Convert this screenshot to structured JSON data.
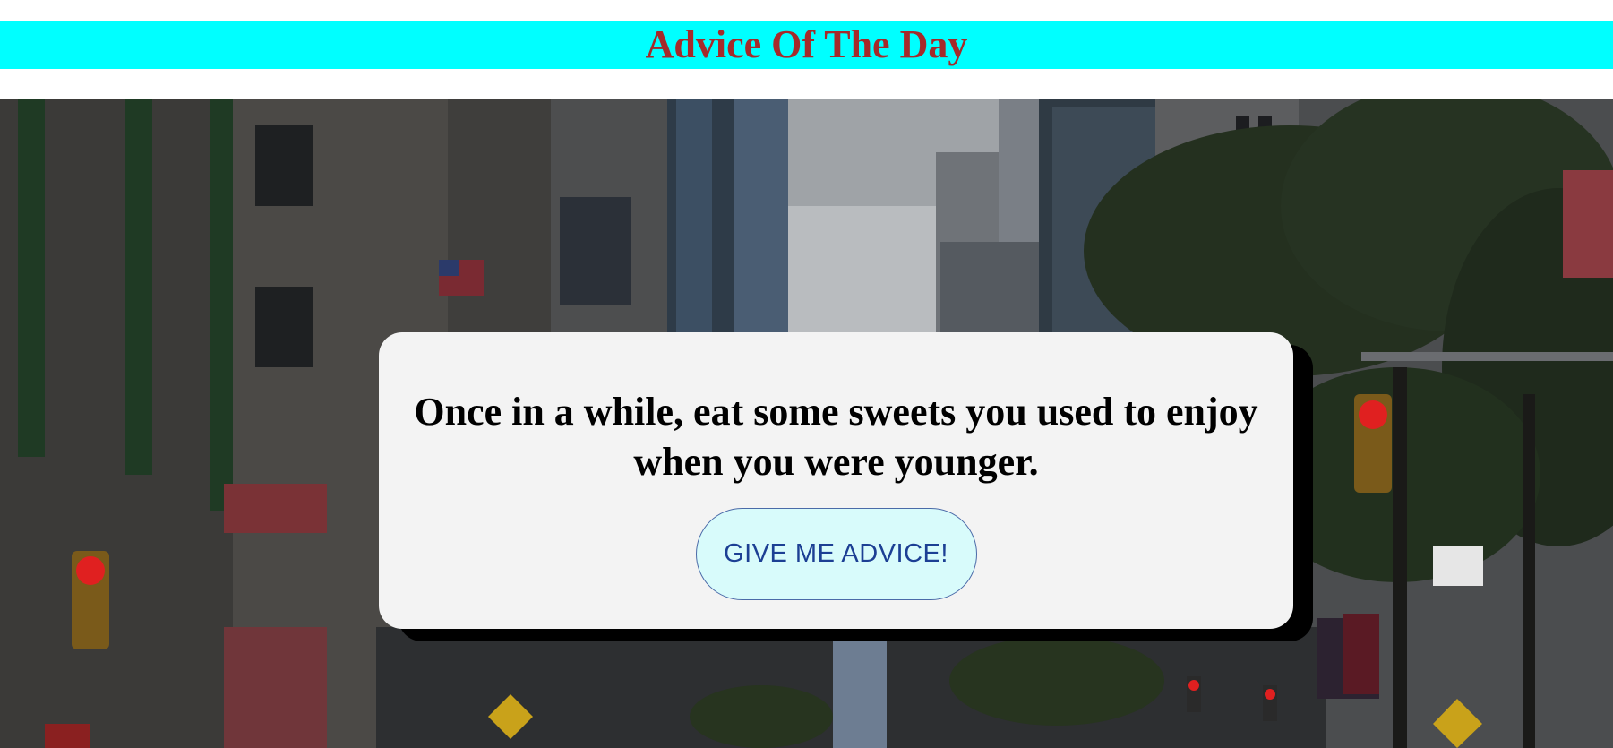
{
  "header": {
    "title": "Advice Of The Day",
    "background_color": "#00ffff",
    "title_color": "#a52a2a"
  },
  "background": {
    "description_icon": "city-street-photo"
  },
  "card": {
    "advice_text": "Once in a while, eat some sweets you used to enjoy when you were younger.",
    "button_label": "GIVE ME ADVICE!",
    "card_color": "#f3f3f3",
    "button_color": "#d8fbfb",
    "button_text_color": "#1c3f94"
  }
}
